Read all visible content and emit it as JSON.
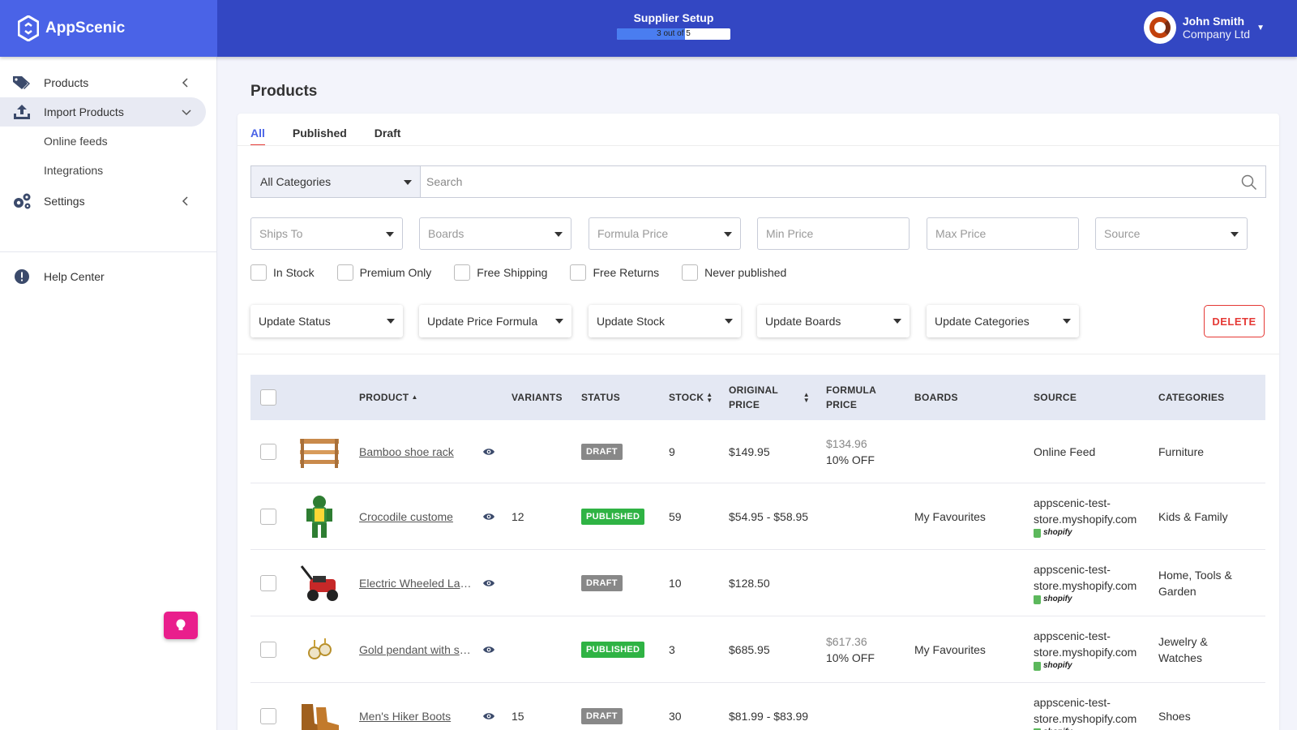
{
  "brand": {
    "name": "AppScenic"
  },
  "setup": {
    "title": "Supplier Setup",
    "progress_text": "3 out of 5",
    "progress": 0.6
  },
  "user": {
    "name": "John Smith",
    "company": "Company Ltd"
  },
  "sidebar": {
    "items": [
      {
        "label": "Products",
        "icon": "tag-icon"
      },
      {
        "label": "Import Products",
        "icon": "upload-icon"
      },
      {
        "label": "Online feeds"
      },
      {
        "label": "Integrations"
      },
      {
        "label": "Settings",
        "icon": "gears-icon"
      },
      {
        "label": "Help Center",
        "icon": "info-icon"
      }
    ]
  },
  "page": {
    "title": "Products"
  },
  "tabs": [
    {
      "label": "All"
    },
    {
      "label": "Published"
    },
    {
      "label": "Draft"
    }
  ],
  "filters": {
    "category": "All Categories",
    "search_placeholder": "Search",
    "ships_to": "Ships To",
    "boards": "Boards",
    "formula_price": "Formula Price",
    "min_price": "Min Price",
    "max_price": "Max Price",
    "source": "Source",
    "checkboxes": [
      "In Stock",
      "Premium Only",
      "Free Shipping",
      "Free Returns",
      "Never published"
    ]
  },
  "bulk_actions": {
    "update_status": "Update Status",
    "update_price_formula": "Update Price Formula",
    "update_stock": "Update Stock",
    "update_boards": "Update Boards",
    "update_categories": "Update Categories",
    "delete": "DELETE"
  },
  "table": {
    "headers": {
      "product": "PRODUCT",
      "variants": "VARIANTS",
      "status": "STATUS",
      "stock": "STOCK",
      "original_price_1": "ORIGINAL",
      "original_price_2": "PRICE",
      "formula_price_1": "FORMULA",
      "formula_price_2": "PRICE",
      "boards": "BOARDS",
      "source": "SOURCE",
      "categories": "CATEGORIES"
    },
    "rows": [
      {
        "product": "Bamboo shoe rack",
        "variants": "",
        "status": "DRAFT",
        "stock": "9",
        "price": "$149.95",
        "formula_price": "$134.96",
        "formula_off": "10% OFF",
        "boards": "",
        "source": "Online Feed",
        "source2": "",
        "shopify": "",
        "categories": "Furniture",
        "categories2": ""
      },
      {
        "product": "Crocodile custome",
        "variants": "12",
        "status": "PUBLISHED",
        "stock": "59",
        "price": "$54.95 - $58.95",
        "formula_price": "",
        "formula_off": "",
        "boards": "My Favourites",
        "source": "appscenic-test-",
        "source2": "store.myshopify.com",
        "shopify": "shopify",
        "categories": "Kids & Family",
        "categories2": ""
      },
      {
        "product": "Electric Wheeled Lawn Mower",
        "variants": "",
        "status": "DRAFT",
        "stock": "10",
        "price": "$128.50",
        "formula_price": "",
        "formula_off": "",
        "boards": "",
        "source": "appscenic-test-",
        "source2": "store.myshopify.com",
        "shopify": "shopify",
        "categories": "Home, Tools &",
        "categories2": "Garden"
      },
      {
        "product": "Gold pendant with shell",
        "variants": "",
        "status": "PUBLISHED",
        "stock": "3",
        "price": "$685.95",
        "formula_price": "$617.36",
        "formula_off": "10% OFF",
        "boards": "My Favourites",
        "source": "appscenic-test-",
        "source2": "store.myshopify.com",
        "shopify": "shopify",
        "categories": "Jewelry &",
        "categories2": "Watches"
      },
      {
        "product": "Men's Hiker Boots",
        "variants": "15",
        "status": "DRAFT",
        "stock": "30",
        "price": "$81.99 - $83.99",
        "formula_price": "",
        "formula_off": "",
        "boards": "",
        "source": "appscenic-test-",
        "source2": "store.myshopify.com",
        "shopify": "shopify",
        "categories": "Shoes",
        "categories2": ""
      }
    ]
  },
  "colors": {
    "header": "#3347c3",
    "brand": "#4a63e7",
    "published": "#2fb344",
    "draft": "#888888",
    "delete": "#e53935",
    "help_fab": "#e91e8c"
  }
}
